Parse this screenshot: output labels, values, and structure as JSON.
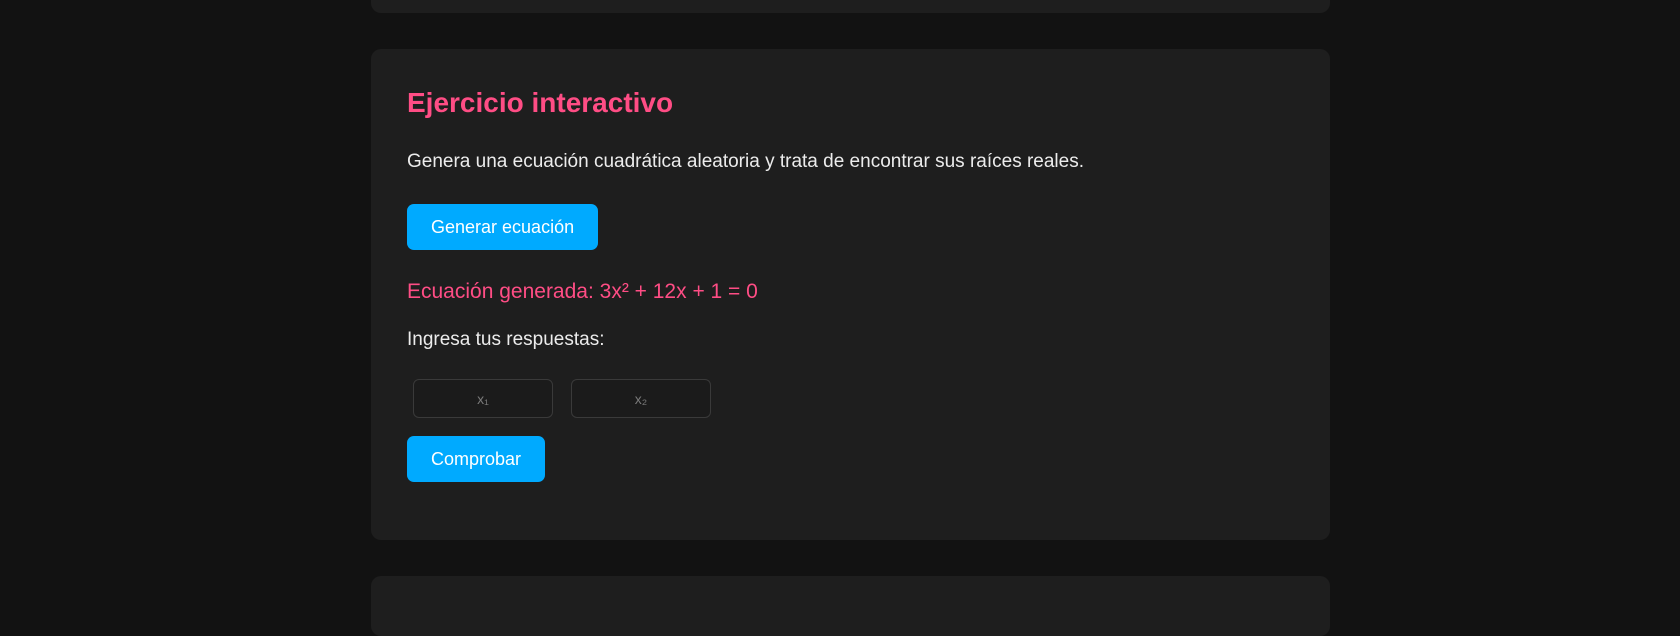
{
  "exercise": {
    "title": "Ejercicio interactivo",
    "description": "Genera una ecuación cuadrática aleatoria y trata de encontrar sus raíces reales.",
    "generate_label": "Generar ecuación",
    "equation_text": "Ecuación generada: 3x² + 12x + 1 = 0",
    "answers_label": "Ingresa tus respuestas:",
    "x1_placeholder": "x₁",
    "x2_placeholder": "x₂",
    "x1_value": "",
    "x2_value": "",
    "check_label": "Comprobar"
  },
  "colors": {
    "accent_pink": "#ff4d85",
    "button_blue": "#00aaff",
    "background": "#121212",
    "card": "#1e1e1e"
  }
}
